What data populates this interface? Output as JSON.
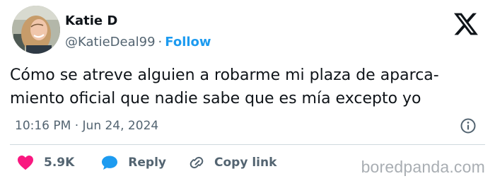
{
  "author": {
    "name": "Katie D",
    "handle": "@KatieDeal99",
    "separator": "·",
    "follow_label": "Follow"
  },
  "tweet": {
    "lines": [
      "Cómo se atreve alguien a robarme mi plaza de aparca-",
      "miento oficial que nadie sabe que es mía excepto yo"
    ],
    "timestamp": "10:16 PM · Jun 24, 2024"
  },
  "actions": {
    "like_count": "5.9K",
    "reply_label": "Reply",
    "copy_link_label": "Copy link"
  },
  "watermark": "boredpanda.com",
  "icons": {
    "platform": "x-logo-icon",
    "info": "info-icon",
    "like": "heart-icon",
    "reply": "reply-bubble-icon",
    "copy": "link-icon"
  },
  "colors": {
    "accent": "#1d9bf0",
    "like": "#f91880",
    "text": "#0f1419",
    "muted": "#536471",
    "watermark": "#a9aeb3"
  }
}
